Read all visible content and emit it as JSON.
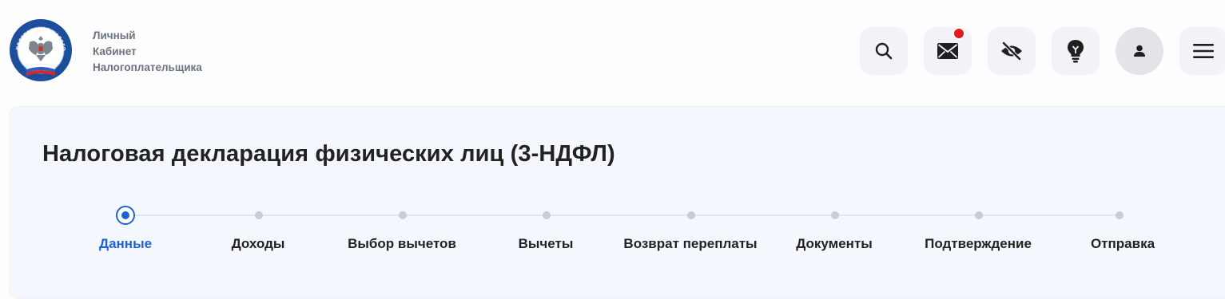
{
  "header": {
    "brand_lines": [
      "Личный",
      "Кабинет",
      "Налогоплательщика"
    ],
    "logo_text": "ФЕДЕРАЛЬНАЯ НАЛОГОВАЯ СЛУЖБА",
    "buttons": [
      {
        "name": "search",
        "icon": "search-icon"
      },
      {
        "name": "messages",
        "icon": "envelope-icon",
        "has_notification": true
      },
      {
        "name": "accessibility",
        "icon": "eye-slash-icon"
      },
      {
        "name": "tips",
        "icon": "lightbulb-icon"
      },
      {
        "name": "profile",
        "icon": "user-icon"
      },
      {
        "name": "menu",
        "icon": "menu-icon"
      }
    ]
  },
  "page": {
    "title": "Налоговая декларация физических лиц (3-НДФЛ)"
  },
  "steps": {
    "active_index": 0,
    "items": [
      {
        "label": "Данные"
      },
      {
        "label": "Доходы"
      },
      {
        "label": "Выбор вычетов"
      },
      {
        "label": "Вычеты"
      },
      {
        "label": "Возврат переплаты"
      },
      {
        "label": "Документы"
      },
      {
        "label": "Подтверждение"
      },
      {
        "label": "Отправка"
      }
    ]
  },
  "colors": {
    "accent": "#1a64d8",
    "notification": "#e5191b",
    "panel_bg": "#f4f7fd"
  }
}
